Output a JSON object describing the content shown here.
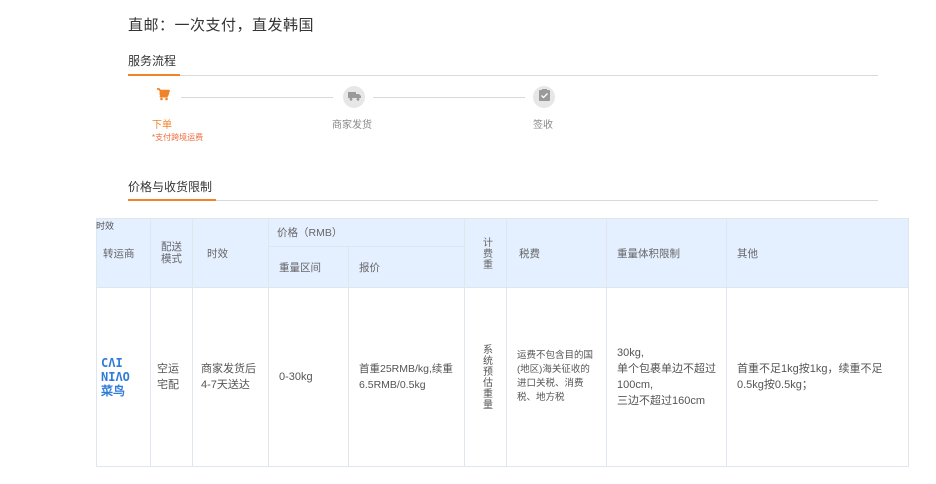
{
  "headline": "直邮：一次支付，直发韩国",
  "process_section": {
    "title": "服务流程"
  },
  "steps": [
    {
      "label": "下单",
      "icon": "cart-icon",
      "note": "*支付跨境运费"
    },
    {
      "label": "商家发货",
      "icon": "truck-icon"
    },
    {
      "label": "签收",
      "icon": "clipboard-check-icon"
    }
  ],
  "limits_section": {
    "title": "价格与收货限制"
  },
  "table": {
    "corner_label": "时效",
    "headers": {
      "carrier": "转运商",
      "mode": "配送模式",
      "time": "时效",
      "price_group": "价格（RMB）",
      "weight_range": "重量区间",
      "quote": "报价",
      "billing_weight": "计费重",
      "tax": "税费",
      "size_limit": "重量体积限制",
      "other": "其他"
    },
    "row": {
      "carrier_logo": "CAI NIAO 菜鸟",
      "mode": "空运宅配",
      "time": "商家发货后4-7天送达",
      "weight_range": "0-30kg",
      "quote": "首重25RMB/kg,续重6.5RMB/0.5kg",
      "billing_weight": "系统预估重量",
      "tax": "运费不包含目的国(地区)海关征收的进口关税、消费税、地方税",
      "size_limit_lines": [
        "30kg,",
        "单个包裹单边不超过100cm,",
        "三边不超过160cm"
      ],
      "other": "首重不足1kg按1kg，续重不足0.5kg按0.5kg；"
    }
  },
  "colors": {
    "accent": "#f0832a",
    "header_bg": "#e4efff",
    "carrier_blue": "#2f7bd8"
  }
}
